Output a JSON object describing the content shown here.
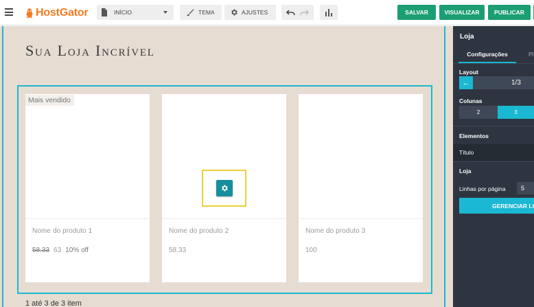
{
  "topbar": {
    "logo_text": "HostGator",
    "page_select_value": "INÍCIO",
    "tema_label": "TEMA",
    "ajustes_label": "AJUSTES",
    "salvar_label": "SALVAR",
    "visualizar_label": "VISUALIZAR",
    "publicar_label": "PUBLICAR",
    "colors": {
      "brand": "#f47a20",
      "action": "#1b9e73",
      "accent": "#1ab8d2"
    }
  },
  "canvas": {
    "store_title": "Sua Loja Incrível",
    "badge": "Mais vendido",
    "products": [
      {
        "name": "Nome do produto 1",
        "old_price": "58.33",
        "price": "63",
        "discount": "10% off"
      },
      {
        "name": "Nome do produto 2",
        "price": "58.33"
      },
      {
        "name": "Nome do produto 3",
        "price": "100"
      }
    ],
    "pagination": "1 até 3 de 3 item"
  },
  "panel": {
    "title": "Loja",
    "tab_config": "Configurações",
    "tab_other": "Pl",
    "layout_label": "Layout",
    "layout_value": "1/3",
    "colunas_label": "Colunas",
    "col_option_2": "2",
    "col_option_3": "3",
    "elementos_label": "Elementos",
    "titulo_label": "Título",
    "loja_label": "Loja",
    "linhas_label": "Linhas por página",
    "linhas_value": "5",
    "manage_label": "GERENCIAR LOJA"
  }
}
